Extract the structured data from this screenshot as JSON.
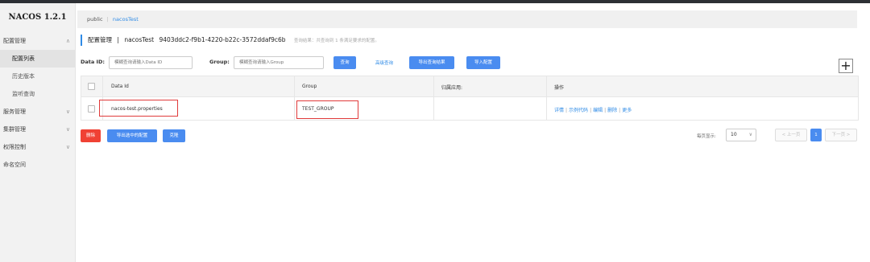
{
  "app": {
    "logo": "NACOS 1.2.1"
  },
  "sidebar": {
    "items": [
      {
        "label": "配置管理",
        "chevron": "∧"
      },
      {
        "label": "配置列表"
      },
      {
        "label": "历史版本"
      },
      {
        "label": "监听查询"
      },
      {
        "label": "服务管理",
        "chevron": "∨"
      },
      {
        "label": "集群管理",
        "chevron": "∨"
      },
      {
        "label": "权限控制",
        "chevron": "∨"
      },
      {
        "label": "命名空间"
      }
    ]
  },
  "breadcrumb": {
    "first": "public",
    "separator": "|",
    "current": "nacosTest"
  },
  "header": {
    "title": "配置管理",
    "separator": "|",
    "namespace": "nacosTest",
    "namespace_id": "9403ddc2-f9b1-4220-b22c-3572ddaf9c6b",
    "hint": "查询结果：共查询到 1 条满足要求的配置。"
  },
  "search": {
    "dataid_label": "Data ID:",
    "dataid_placeholder": "模糊查询请输入Data ID",
    "group_label": "Group:",
    "group_placeholder": "模糊查询请输入Group",
    "query_button": "查询",
    "advanced_link": "高级查询",
    "export_button": "导出查询结果",
    "import_button": "导入配置",
    "add_symbol": "+"
  },
  "table": {
    "columns": [
      "Data Id",
      "Group",
      "归属应用:",
      "操作"
    ],
    "rows": [
      {
        "data_id": "nacos-test.properties",
        "group": "TEST_GROUP",
        "app": "",
        "actions": [
          "详情",
          "示例代码",
          "编辑",
          "删除",
          "更多"
        ]
      }
    ],
    "action_separator": "|"
  },
  "bottom": {
    "delete_button": "删除",
    "export_selected_button": "导出选中的配置",
    "clone_button": "克隆",
    "page_size_label": "每页显示:",
    "page_size": "10",
    "select_chevron": "∨",
    "prev": "< 上一页",
    "current_page": "1",
    "next": "下一页 >"
  },
  "colors": {
    "accent": "#4a8cf0",
    "link": "#2f8be6",
    "danger": "#f04134",
    "highlight": "#e03a3a"
  }
}
